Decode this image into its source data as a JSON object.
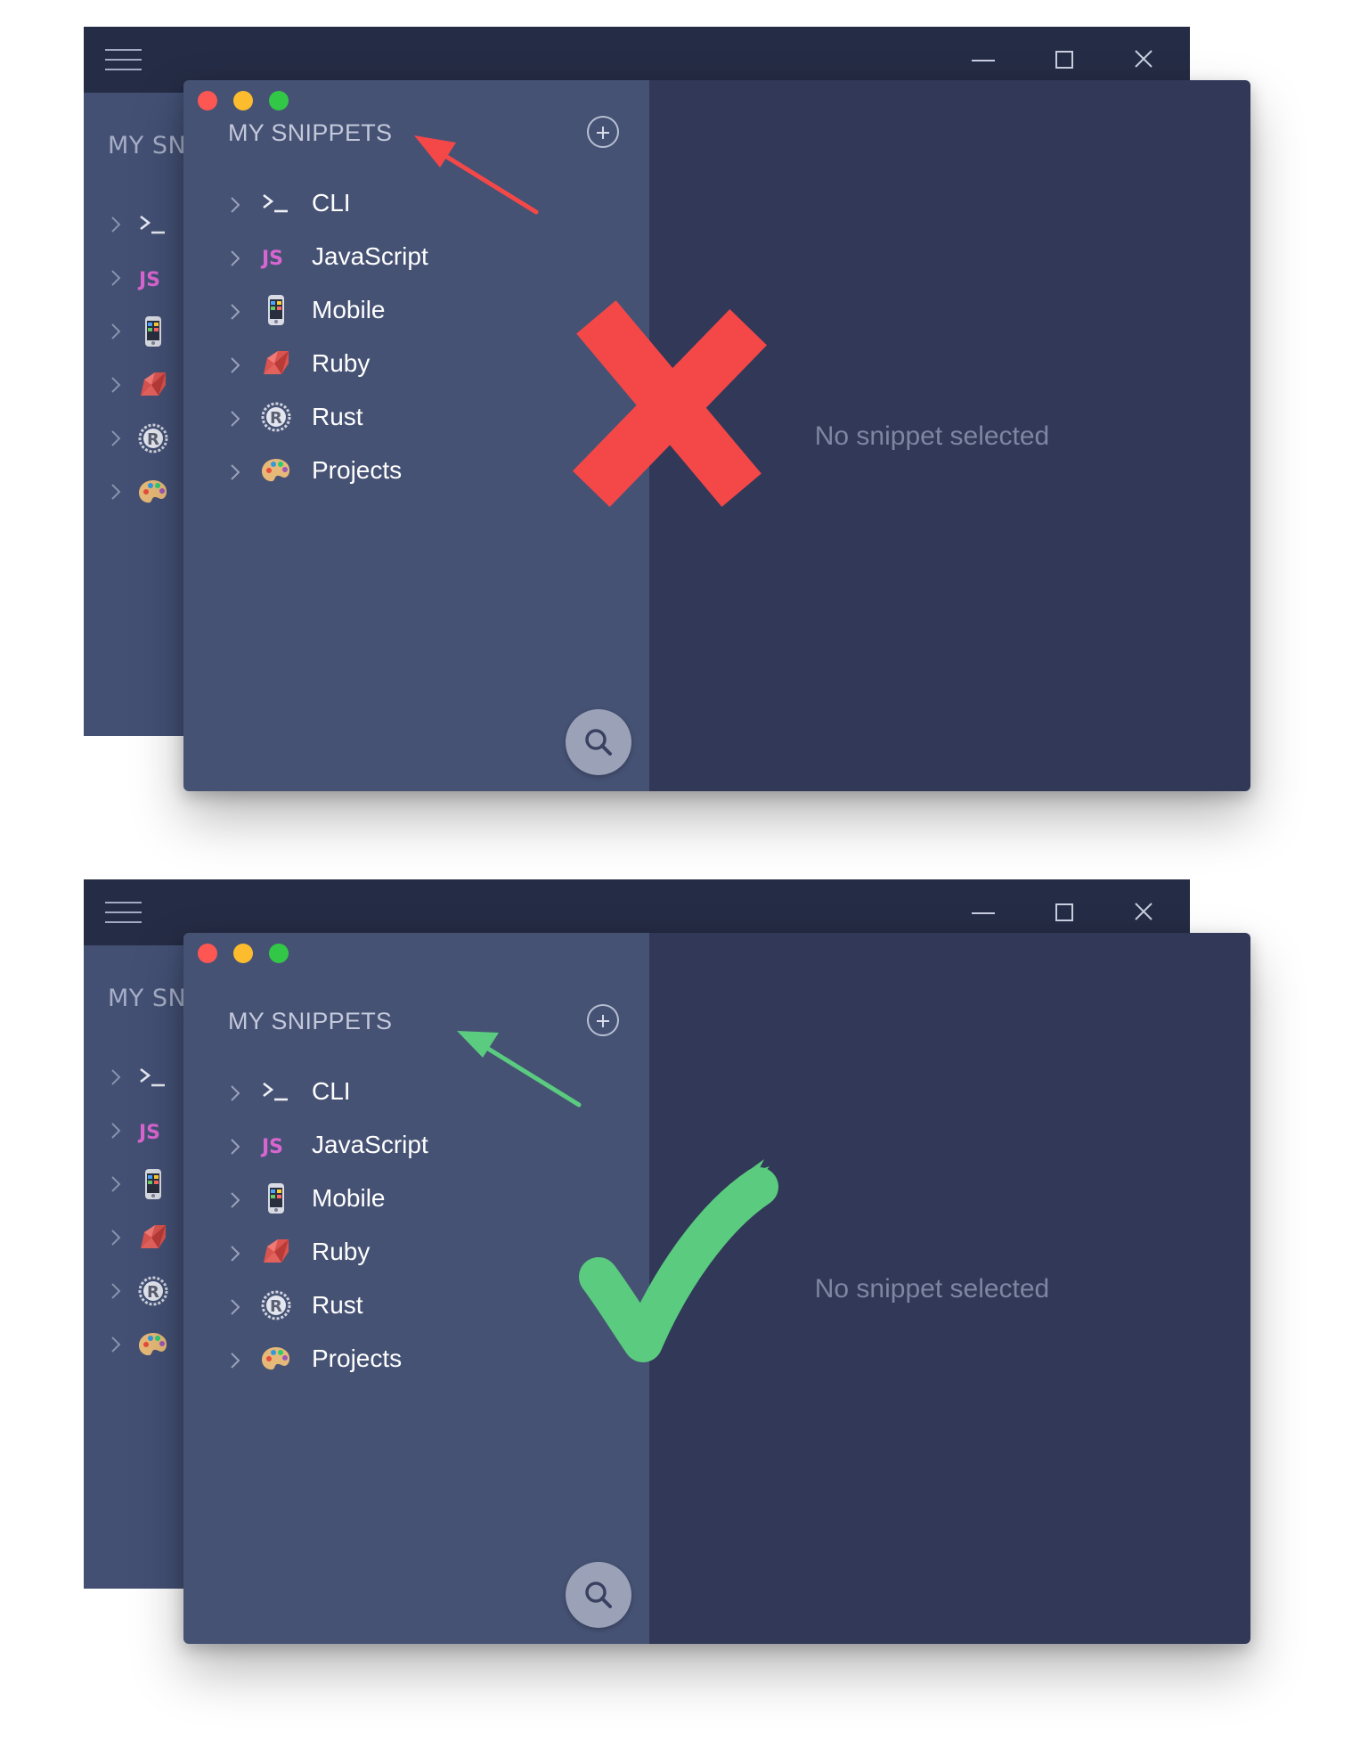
{
  "panels": [
    {
      "verdict": "incorrect",
      "background_window": {
        "header": "MY SN"
      },
      "foreground_window": {
        "header": "MY SNIPPETS",
        "items": [
          {
            "label": "CLI",
            "icon": "terminal-icon"
          },
          {
            "label": "JavaScript",
            "icon": "js-icon"
          },
          {
            "label": "Mobile",
            "icon": "mobile-phone-icon"
          },
          {
            "label": "Ruby",
            "icon": "ruby-icon"
          },
          {
            "label": "Rust",
            "icon": "rust-icon"
          },
          {
            "label": "Projects",
            "icon": "palette-icon"
          }
        ],
        "empty_message": "No snippet selected"
      }
    },
    {
      "verdict": "correct",
      "background_window": {
        "header": "MY SN"
      },
      "foreground_window": {
        "header": "MY SNIPPETS",
        "items": [
          {
            "label": "CLI",
            "icon": "terminal-icon"
          },
          {
            "label": "JavaScript",
            "icon": "js-icon"
          },
          {
            "label": "Mobile",
            "icon": "mobile-phone-icon"
          },
          {
            "label": "Ruby",
            "icon": "ruby-icon"
          },
          {
            "label": "Rust",
            "icon": "rust-icon"
          },
          {
            "label": "Projects",
            "icon": "palette-icon"
          }
        ],
        "empty_message": "No snippet selected"
      }
    }
  ],
  "colors": {
    "background_window_titlebar": "#252c45",
    "background_window_body": "#435074",
    "sidebar": "#465274",
    "main_pane": "#313858",
    "js_icon": "#d966d0",
    "traffic_red": "#fc5753",
    "traffic_yellow": "#fdbc2e",
    "traffic_green": "#33c748",
    "annotation_wrong": "#f44848",
    "annotation_right": "#5acb7f"
  }
}
